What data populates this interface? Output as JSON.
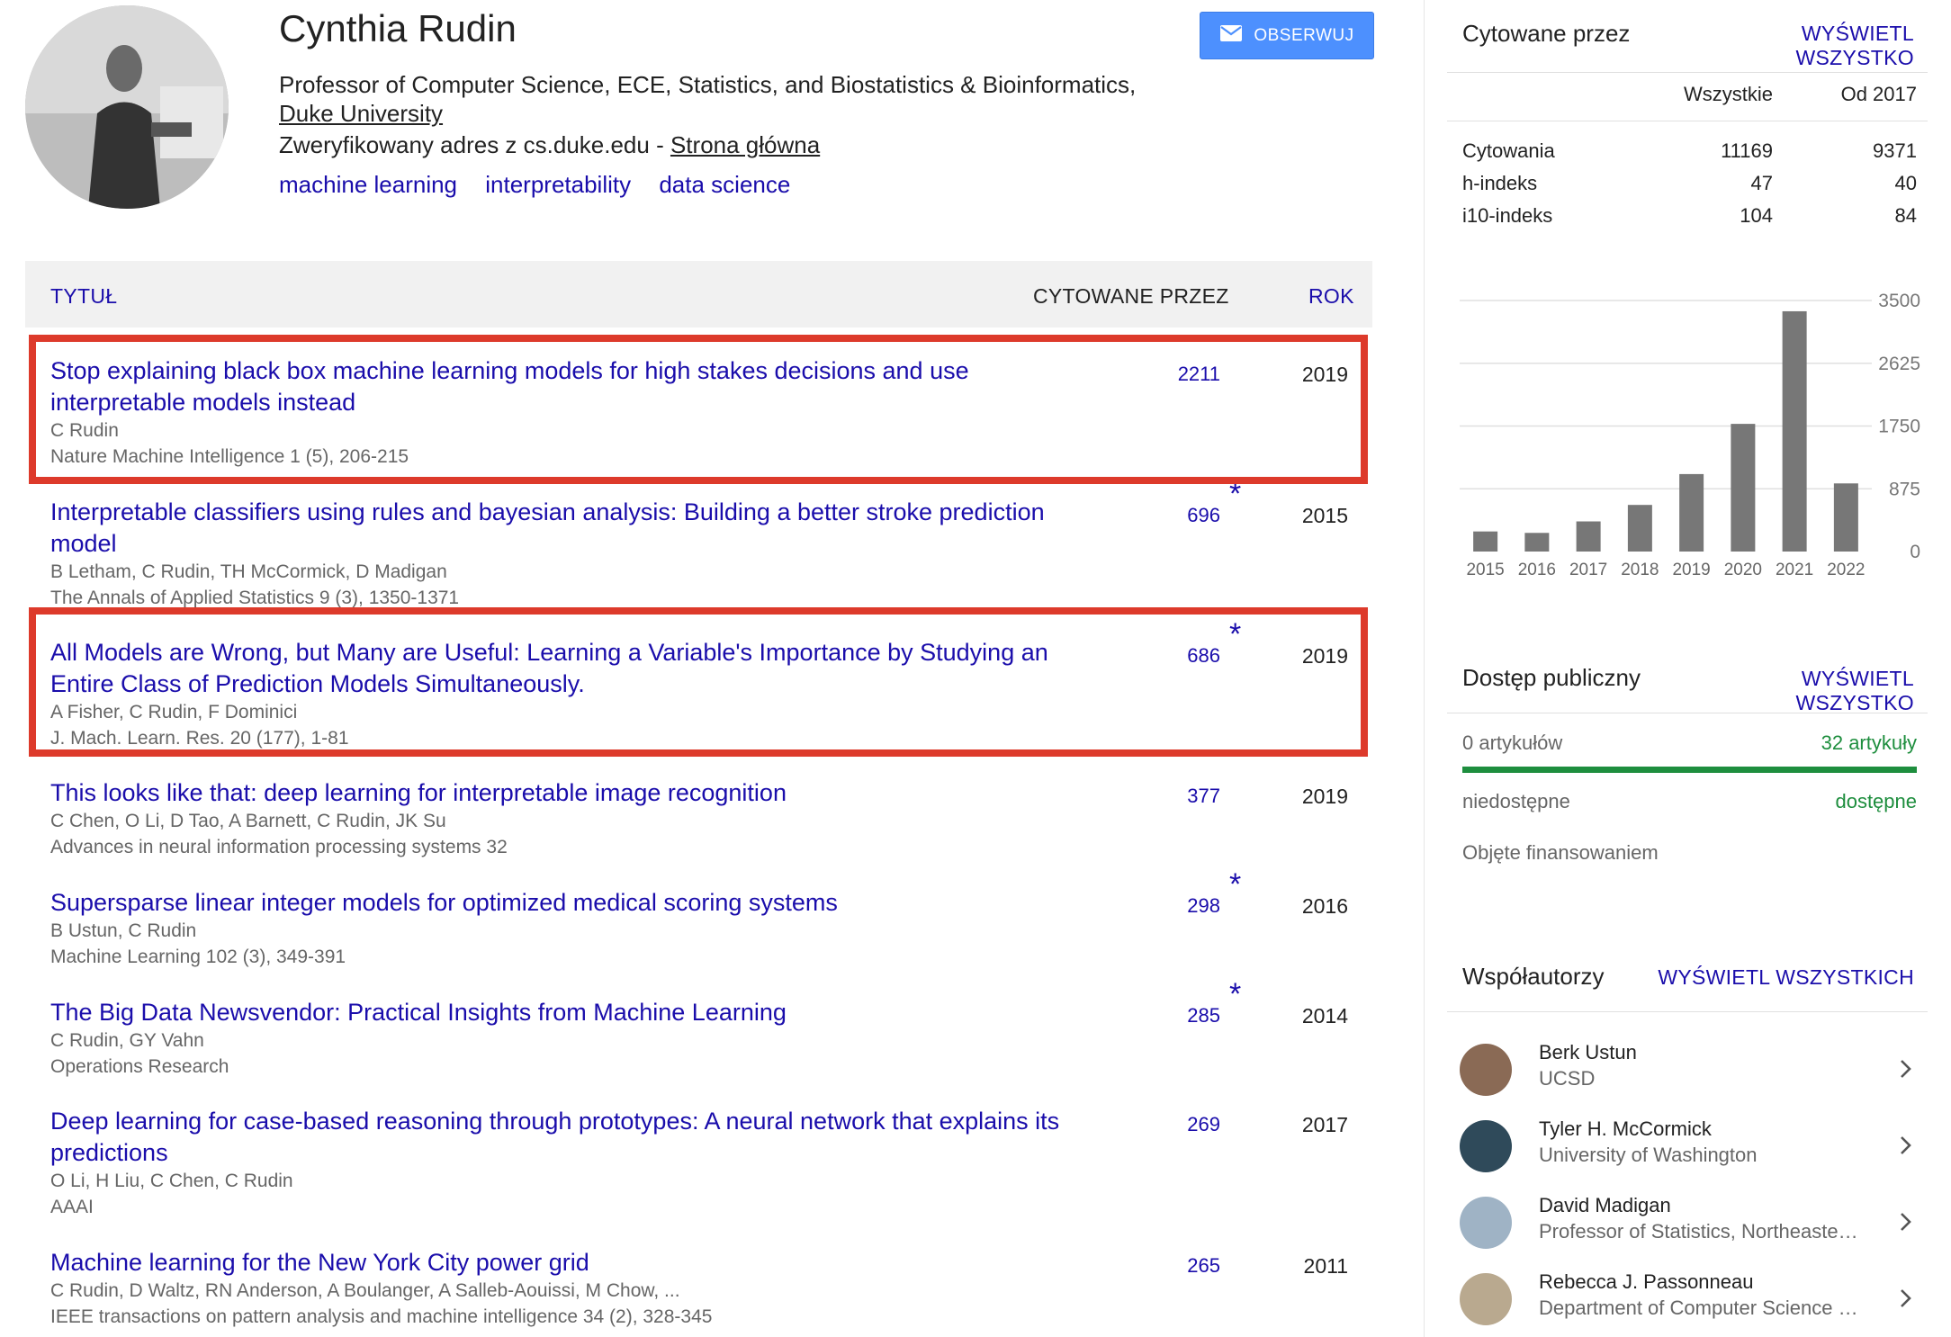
{
  "profile": {
    "name": "Cynthia Rudin",
    "affiliation": "Professor of Computer Science, ECE, Statistics, and Biostatistics & Bioinformatics,",
    "university": "Duke University",
    "verified_prefix": "Zweryfikowany adres z cs.duke.edu - ",
    "homepage": "Strona główna",
    "interests": [
      "machine learning",
      "interpretability",
      "data science"
    ],
    "follow_label": "OBSERWUJ"
  },
  "table": {
    "col_title": "TYTUŁ",
    "col_cited": "CYTOWANE PRZEZ",
    "col_year": "ROK",
    "rows": [
      {
        "title_l1": "Stop explaining black box machine learning models for high stakes decisions and use",
        "title_l2": "interpretable models instead",
        "authors": "C Rudin",
        "venue": "Nature Machine Intelligence 1 (5), 206-215",
        "cites": "2211",
        "star": "",
        "year": "2019"
      },
      {
        "title_l1": "Interpretable classifiers using rules and bayesian analysis: Building a better stroke prediction",
        "title_l2": "model",
        "authors": "B Letham, C Rudin, TH McCormick, D Madigan",
        "venue": "The Annals of Applied Statistics 9 (3), 1350-1371",
        "cites": "696",
        "star": "*",
        "year": "2015"
      },
      {
        "title_l1": "All Models are Wrong, but Many are Useful: Learning a Variable's Importance by Studying an",
        "title_l2": "Entire Class of Prediction Models Simultaneously.",
        "authors": "A Fisher, C Rudin, F Dominici",
        "venue": "J. Mach. Learn. Res. 20 (177), 1-81",
        "cites": "686",
        "star": "*",
        "year": "2019"
      },
      {
        "title_l1": "This looks like that: deep learning for interpretable image recognition",
        "title_l2": "",
        "authors": "C Chen, O Li, D Tao, A Barnett, C Rudin, JK Su",
        "venue": "Advances in neural information processing systems 32",
        "cites": "377",
        "star": "",
        "year": "2019"
      },
      {
        "title_l1": "Supersparse linear integer models for optimized medical scoring systems",
        "title_l2": "",
        "authors": "B Ustun, C Rudin",
        "venue": "Machine Learning 102 (3), 349-391",
        "cites": "298",
        "star": "*",
        "year": "2016"
      },
      {
        "title_l1": "The Big Data Newsvendor: Practical Insights from Machine Learning",
        "title_l2": "",
        "authors": "C Rudin, GY Vahn",
        "venue": "Operations Research",
        "cites": "285",
        "star": "*",
        "year": "2014"
      },
      {
        "title_l1": "Deep learning for case-based reasoning through prototypes: A neural network that explains its",
        "title_l2": "predictions",
        "authors": "O Li, H Liu, C Chen, C Rudin",
        "venue": "AAAI",
        "cites": "269",
        "star": "",
        "year": "2017"
      },
      {
        "title_l1": "Machine learning for the New York City power grid",
        "title_l2": "",
        "authors": "C Rudin, D Waltz, RN Anderson, A Boulanger, A Salleb-Aouissi, M Chow, ...",
        "venue": "IEEE transactions on pattern analysis and machine intelligence 34 (2), 328-345",
        "cites": "265",
        "star": "",
        "year": "2011"
      }
    ]
  },
  "cited_by": {
    "heading": "Cytowane przez",
    "view_all": "WYŚWIETL WSZYSTKO",
    "col_all": "Wszystkie",
    "col_since": "Od 2017",
    "stats": [
      {
        "label": "Cytowania",
        "all": "11169",
        "since": "9371"
      },
      {
        "label": "h-indeks",
        "all": "47",
        "since": "40"
      },
      {
        "label": "i10-indeks",
        "all": "104",
        "since": "84"
      }
    ]
  },
  "chart_data": {
    "type": "bar",
    "categories": [
      "2015",
      "2016",
      "2017",
      "2018",
      "2019",
      "2020",
      "2021",
      "2022"
    ],
    "values": [
      280,
      260,
      420,
      650,
      1080,
      1780,
      3350,
      950
    ],
    "ylim": [
      0,
      3500
    ],
    "yticks": [
      "3500",
      "2625",
      "1750",
      "875",
      "0"
    ],
    "bar_color": "#777777"
  },
  "public_access": {
    "heading": "Dostęp publiczny",
    "view_all": "WYŚWIETL WSZYSTKO",
    "left_count": "0 artykułów",
    "right_count": "32 artykuły",
    "left_label": "niedostępne",
    "right_label": "dostępne",
    "funding": "Objęte finansowaniem",
    "available_fraction": 1.0,
    "green": "#1e8e3e"
  },
  "coauthors": {
    "heading": "Współautorzy",
    "view_all": "WYŚWIETL WSZYSTKICH",
    "items": [
      {
        "name": "Berk Ustun",
        "affiliation": "UCSD"
      },
      {
        "name": "Tyler H. McCormick",
        "affiliation": "University of Washington"
      },
      {
        "name": "David Madigan",
        "affiliation": "Professor of Statistics, Northeastern University"
      },
      {
        "name": "Rebecca J. Passonneau",
        "affiliation": "Department of Computer Science and Engineering"
      }
    ]
  }
}
